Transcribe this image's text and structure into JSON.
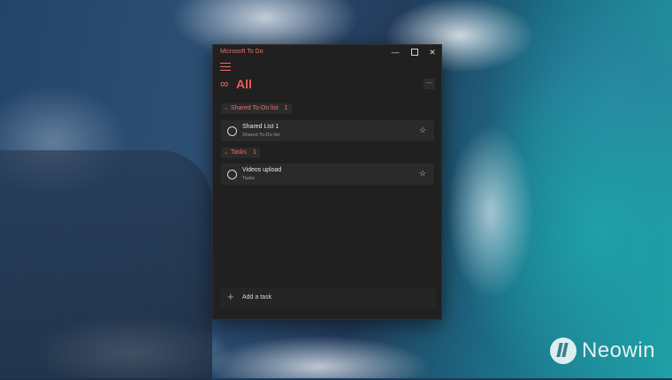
{
  "window": {
    "app_title": "Microsoft To Do",
    "controls": {
      "minimize": "—",
      "close": "✕"
    }
  },
  "header": {
    "list_icon": "infinity-icon",
    "list_title": "All",
    "more_label": "···"
  },
  "groups": [
    {
      "name": "Shared To-Do list",
      "count": "1",
      "tasks": [
        {
          "name": "Shared List 1",
          "list": "Shared To-Do list",
          "starred": false
        }
      ]
    },
    {
      "name": "Tasks",
      "count": "1",
      "tasks": [
        {
          "name": "Videos upload",
          "list": "Tasks",
          "starred": false
        }
      ]
    }
  ],
  "add_task": {
    "plus": "+",
    "label": "Add a task"
  },
  "watermark": {
    "text": "Neowin"
  },
  "colors": {
    "accent": "#e8706e",
    "title": "#f05a5a",
    "background": "#202020"
  }
}
